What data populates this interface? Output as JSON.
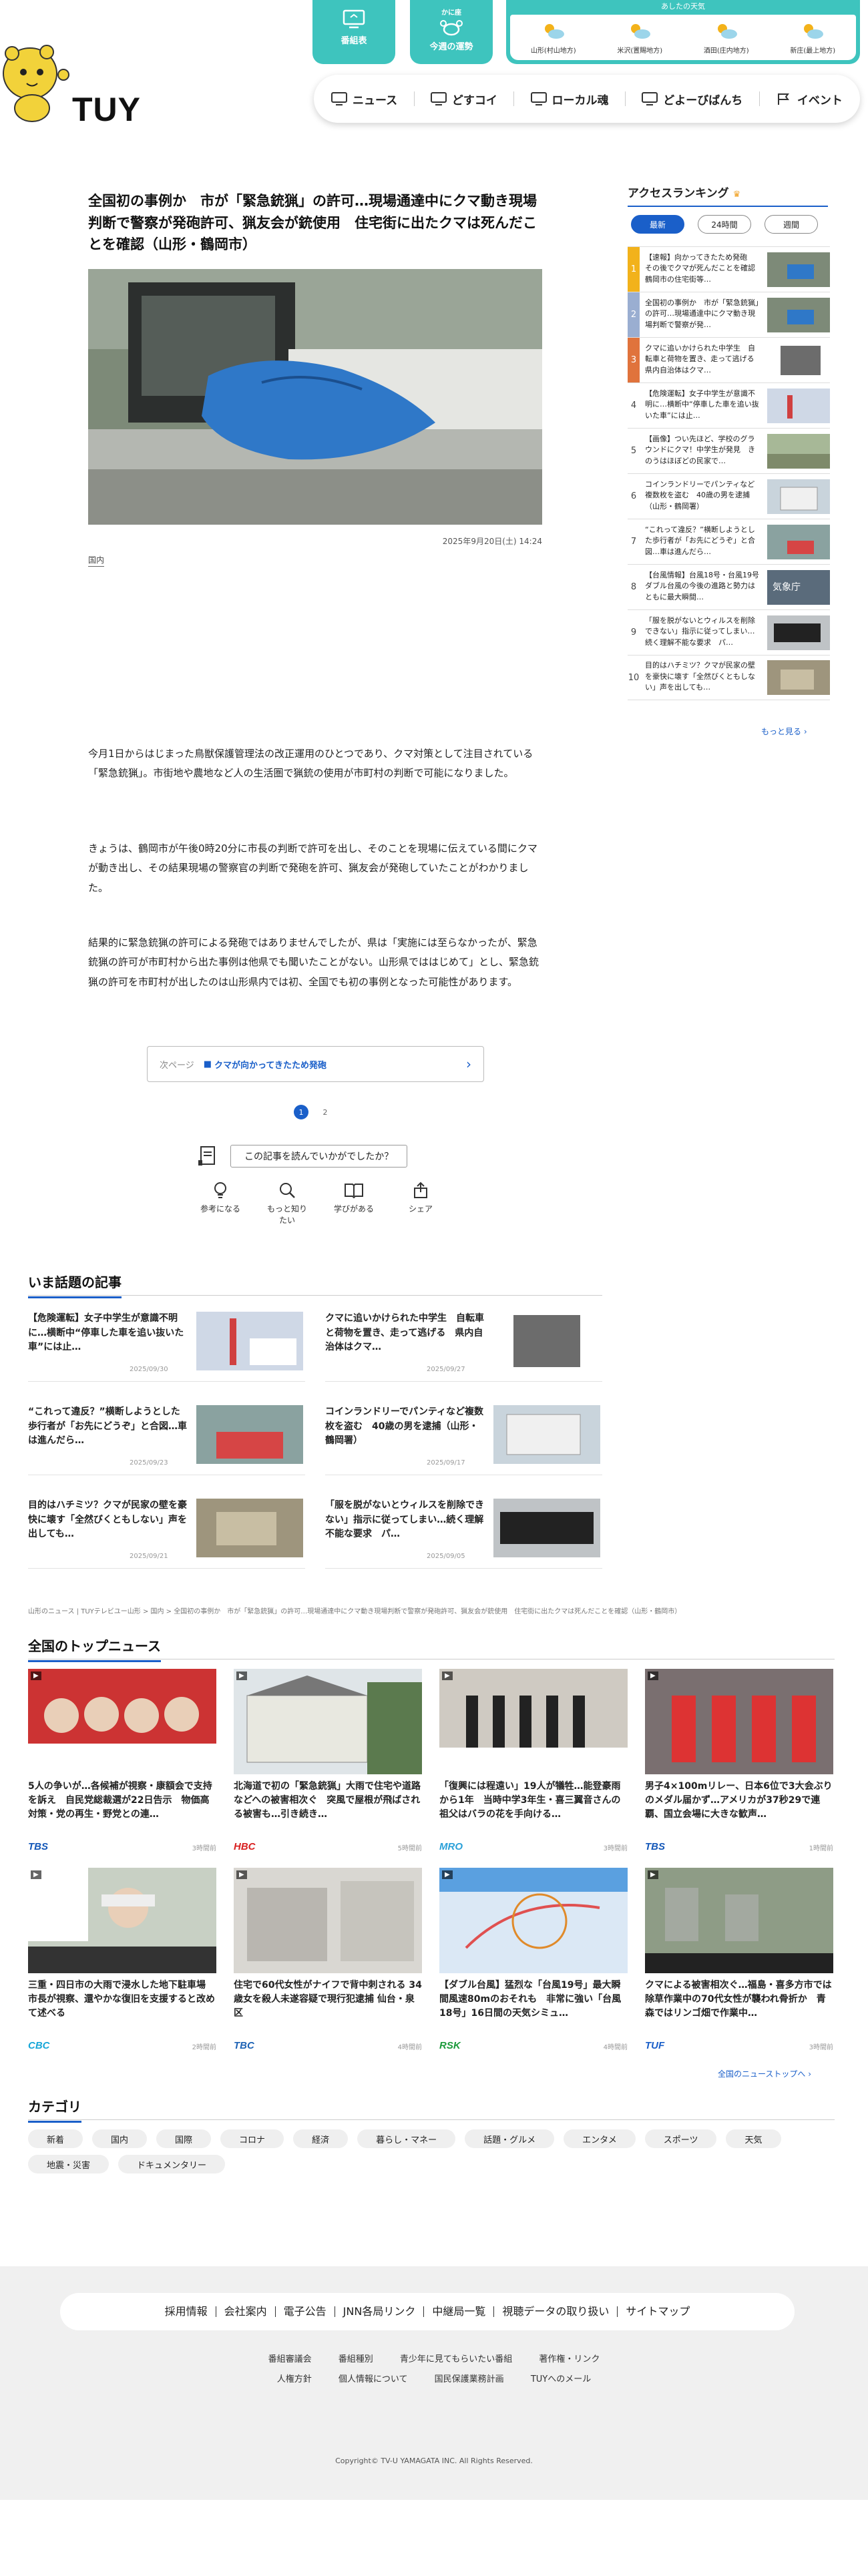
{
  "header": {
    "logo": "TUY",
    "top_buttons": [
      {
        "label": "番組表"
      },
      {
        "label": "今週の運勢",
        "sub": "かに座"
      }
    ],
    "weather": {
      "title": "あしたの天気",
      "areas": [
        "山形(村山地方)",
        "米沢(置賜地方)",
        "酒田(庄内地方)",
        "新庄(最上地方)"
      ]
    },
    "nav": [
      "ニュース",
      "どすコイ",
      "ローカル魂",
      "どよーびばんち",
      "イベント"
    ]
  },
  "article": {
    "title": "全国初の事例か　市が「緊急銃猟」の許可…現場通達中にクマ動き現場判断で警察が発砲許可、猟友会が銃使用　住宅街に出たクマは死んだことを確認（山形・鶴岡市）",
    "date": "2025年9月20日(土) 14:24",
    "category": "国内",
    "paragraphs": [
      "今月1日からはじまった鳥獣保護管理法の改正運用のひとつであり、クマ対策として注目されている「緊急銃猟」。市街地や農地など人の生活圏で猟銃の使用が市町村の判断で可能になりました。",
      "きょうは、鶴岡市が午後0時20分に市長の判断で許可を出し、そのことを現場に伝えている間にクマが動き出し、その結果現場の警察官の判断で発砲を許可、猟友会が発砲していたことがわかりました。",
      "結果的に緊急銃猟の許可による発砲ではありませんでしたが、県は「実施には至らなかったが、緊急銃猟の許可が市町村から出た事例は他県でも聞いたことがない。山形県でははじめて」とし、緊急銃猟の許可を市町村が出したのは山形県内では初、全国でも初の事例となった可能性があります。"
    ],
    "next": {
      "label": "次ページ",
      "title": "クマが向かってきたため発砲"
    },
    "pages": [
      "1",
      "2"
    ],
    "feedback_question": "この記事を読んでいかがでしたか？",
    "reactions": [
      "参考になる",
      "もっと知りたい",
      "学びがある",
      "シェア"
    ]
  },
  "ranking": {
    "title": "アクセスランキング",
    "tabs": [
      "最新",
      "24時間",
      "週間"
    ],
    "items": [
      {
        "rank": "1",
        "text": "【速報】向かってきたため発砲　その後でクマが死んだことを確認　鶴岡市の住宅街等…"
      },
      {
        "rank": "2",
        "text": "全国初の事例か　市が「緊急銃猟」の許可…現場通達中にクマ動き現場判断で警察が発…"
      },
      {
        "rank": "3",
        "text": "クマに追いかけられた中学生　自転車と荷物を置き、走って逃げる　県内自治体はクマ…"
      },
      {
        "rank": "4",
        "text": "【危険運転】女子中学生が意識不明に…横断中“停車した車を追い抜いた車”には止…"
      },
      {
        "rank": "5",
        "text": "【画像】つい先ほど、学校のグラウンドにクマ！中学生が発見　きのうはほぼどの民家で…"
      },
      {
        "rank": "6",
        "text": "コインランドリーでパンティなど複数枚を盗む　40歳の男を逮捕（山形・鶴岡署）"
      },
      {
        "rank": "7",
        "text": "“これって違反？”横断しようとした歩行者が「お先にどうぞ」と合図…車は進んだら…"
      },
      {
        "rank": "8",
        "text": "【台風情報】台風18号・台風19号　ダブル台風の今後の進路と勢力は　ともに最大瞬間…"
      },
      {
        "rank": "9",
        "text": "「服を脱がないとウィルスを削除できない」指示に従ってしまい…続く理解不能な要求　パ…"
      },
      {
        "rank": "10",
        "text": "目的はハチミツ？クマが民家の壁を豪快に壊す「全然びくともしない」声を出しても…"
      }
    ],
    "more": "もっと見る"
  },
  "hot": {
    "title": "いま話題の記事",
    "items": [
      {
        "text": "【危険運転】女子中学生が意識不明に…横断中“停車した車を追い抜いた車”には止…",
        "date": "2025/09/30"
      },
      {
        "text": "クマに追いかけられた中学生　自転車と荷物を置き、走って逃げる　県内自治体はクマ…",
        "date": "2025/09/27"
      },
      {
        "text": "“これって違反？”横断しようとした歩行者が「お先にどうぞ」と合図…車は進んだら…",
        "date": "2025/09/23"
      },
      {
        "text": "コインランドリーでパンティなど複数枚を盗む　40歳の男を逮捕（山形・鶴岡署）",
        "date": "2025/09/17"
      },
      {
        "text": "目的はハチミツ？クマが民家の壁を豪快に壊す「全然びくともしない」声を出しても…",
        "date": "2025/09/21"
      },
      {
        "text": "「服を脱がないとウィルスを削除できない」指示に従ってしまい…続く理解不能な要求　パ…",
        "date": "2025/09/05"
      }
    ]
  },
  "breadcrumb": "山形のニュース | TUYテレビユー山形 > 国内 > 全国初の事例か　市が「緊急銃猟」の許可…現場通達中にクマ動き現場判断で警察が発砲許可、猟友会が銃使用　住宅街に出たクマは死んだことを確認（山形・鶴岡市）",
  "topnews": {
    "title": "全国のトップニュース",
    "items": [
      {
        "text": "5人の争いが…各候補が視察・康額会で支持を訴え　自民党総裁選が22日告示　物価高対策・党の再生・野党との連…",
        "src": "TBS",
        "time": "3時間前",
        "color": "#1357b8"
      },
      {
        "text": "北海道で初の「緊急銃猟」大雨で住宅や道路などへの被害相次ぐ　突風で屋根が飛ばされる被害も…引き続き…",
        "src": "HBC",
        "time": "5時間前",
        "color": "#d92020"
      },
      {
        "text": "「復興には程遠い」19人が犠牲…能登豪雨から1年　当時中学3年生・喜三翼音さんの祖父はバラの花を手向ける…",
        "src": "MRO",
        "time": "3時間前",
        "color": "#2aa0d8"
      },
      {
        "text": "男子4×100mリレー、日本6位で3大会ぶりのメダル届かず…アメリカが37秒29で連覇、国立会場に大きな歓声…",
        "src": "TBS",
        "time": "1時間前",
        "color": "#1357b8"
      },
      {
        "text": "三重・四日市の大雨で浸水した地下駐車場 市長が視察、還やかな復旧を支援すると改めて述べる",
        "src": "CBC",
        "time": "2時間前",
        "color": "#18a7d8"
      },
      {
        "text": "住宅で60代女性がナイフで背中刺される 34歳女を殺人未遂容疑で現行犯逮捕 仙台・泉区",
        "src": "TBC",
        "time": "4時間前",
        "color": "#1e63b5"
      },
      {
        "text": "【ダブル台風】猛烈な「台風19号」最大瞬間風速80mのおそれも　非常に強い「台風18号」16日間の天気シミュ…",
        "src": "RSK",
        "time": "4時間前",
        "color": "#1a9a3a"
      },
      {
        "text": "クマによる被害相次ぐ…福島・喜多方市では除草作業中の70代女性が襲われ骨折か　青森ではリンゴ畑で作業中…",
        "src": "TUF",
        "time": "3時間前",
        "color": "#1a5fc9"
      }
    ],
    "more": "全国のニューストップへ"
  },
  "categories": {
    "title": "カテゴリ",
    "items": [
      "新着",
      "国内",
      "国際",
      "コロナ",
      "経済",
      "暮らし・マネー",
      "話題・グルメ",
      "エンタメ",
      "スポーツ",
      "天気",
      "地震・災害",
      "ドキュメンタリー"
    ]
  },
  "footer": {
    "main_links": [
      "採用情報",
      "会社案内",
      "電子公告",
      "JNN各局リンク",
      "中継局一覧",
      "視聴データの取り扱い",
      "サイトマップ"
    ],
    "sub_links_row1": [
      "番組審議会",
      "番組種別",
      "青少年に見てもらいたい番組",
      "著作権・リンク"
    ],
    "sub_links_row2": [
      "人権方針",
      "個人情報について",
      "国民保護業務計画",
      "TUYへのメール"
    ],
    "copyright": "Copyright© TV-U YAMAGATA INC. All Rights Reserved."
  },
  "colors": {
    "accent": "#1a5fc9",
    "teal": "#3ec4be"
  }
}
